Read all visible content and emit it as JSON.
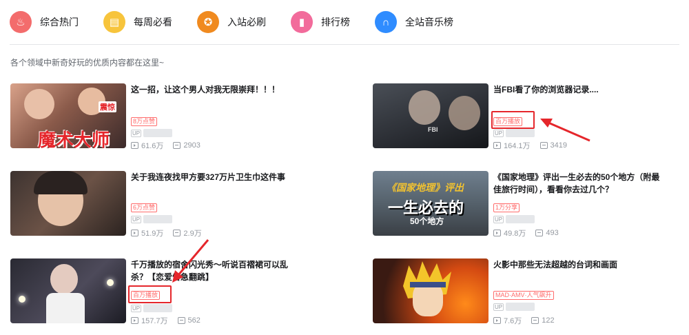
{
  "tabs": [
    {
      "label": "综合热门",
      "color": "#f36c6c",
      "icon": "flame-icon",
      "glyph": "♨"
    },
    {
      "label": "每周必看",
      "color": "#f7c43c",
      "icon": "calendar-icon",
      "glyph": "▤"
    },
    {
      "label": "入站必刷",
      "color": "#f08a1f",
      "icon": "medal-icon",
      "glyph": "✪"
    },
    {
      "label": "排行榜",
      "color": "#f26b9b",
      "icon": "ranking-icon",
      "glyph": "▮"
    },
    {
      "label": "全站音乐榜",
      "color": "#2f8cff",
      "icon": "headphones-icon",
      "glyph": "∩"
    }
  ],
  "subtitle": "各个领域中新奇好玩的优质内容都在这里~",
  "cards": [
    {
      "title": "这一招，让这个男人对我无限崇拜！！！",
      "badge": "8万点赞",
      "views": "61.6万",
      "danmaku": "2903",
      "thumb_text": "魔术大师",
      "thumb_tag": "震惊",
      "up": "UP"
    },
    {
      "title": "当FBI看了你的浏览器记录....",
      "badge": "百万播放",
      "views": "164.1万",
      "danmaku": "3419",
      "thumb_text": "FBI",
      "up": "UP"
    },
    {
      "title": "关于我连夜找甲方要327万片卫生巾这件事",
      "badge": "6万点赞",
      "views": "51.9万",
      "danmaku": "2.9万",
      "up": "UP"
    },
    {
      "title": "《国家地理》评出一生必去的50个地方（附最佳旅行时间），看看你去过几个？",
      "badge": "1万分享",
      "views": "49.8万",
      "danmaku": "493",
      "thumb_text": "《国家地理》评出",
      "thumb_text2": "一生必去的",
      "thumb_text3": "50个地方",
      "up": "UP"
    },
    {
      "title": "千万播放的宿舍闪光秀～听说百褶裙可以乱杀？【恋爱告急翻跳】",
      "badge": "百万播放",
      "views": "157.7万",
      "danmaku": "562",
      "up": "UP"
    },
    {
      "title": "火影中那些无法超越的台词和画面",
      "badge": "MAD·AMV·人气飙升",
      "views": "7.6万",
      "danmaku": "122",
      "up": "UP"
    }
  ]
}
